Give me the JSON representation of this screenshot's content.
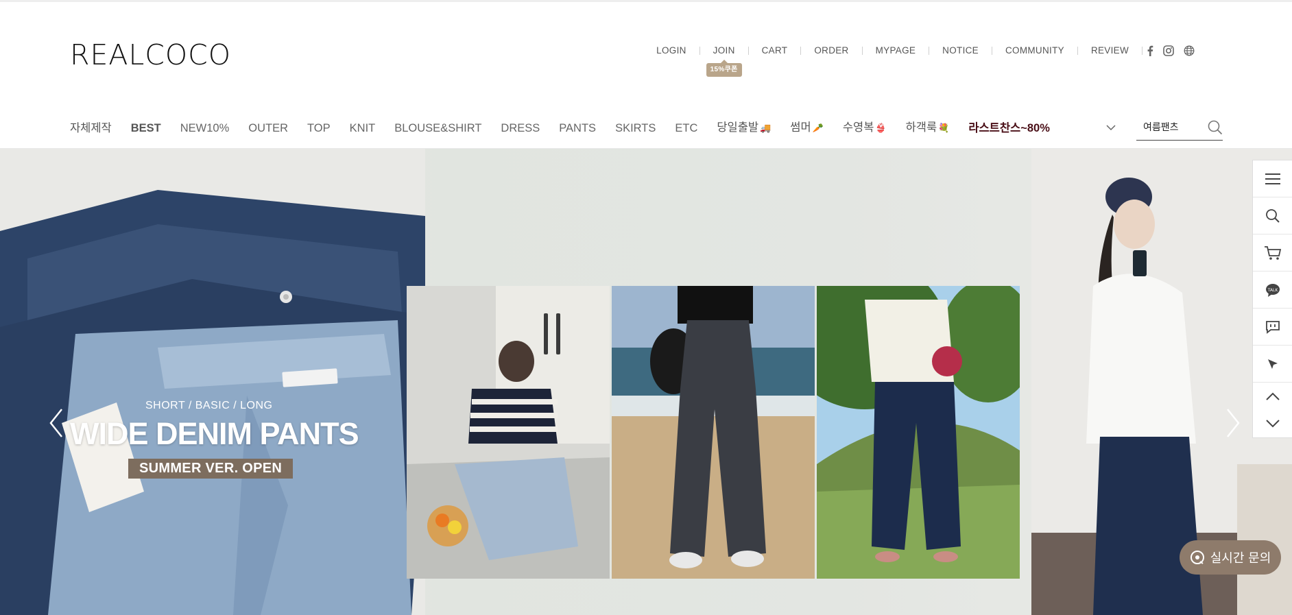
{
  "brand": {
    "logo_text": "REALCOCO"
  },
  "top_nav": {
    "items": [
      "LOGIN",
      "JOIN",
      "CART",
      "ORDER",
      "MYPAGE",
      "NOTICE",
      "COMMUNITY",
      "REVIEW"
    ],
    "join_badge": "15%쿠폰",
    "social_icons": [
      "facebook-icon",
      "instagram-icon",
      "globe-icon"
    ]
  },
  "main_nav": {
    "categories": [
      "자체제작",
      "BEST",
      "NEW10%",
      "OUTER",
      "TOP",
      "KNIT",
      "BLOUSE&SHIRT",
      "DRESS",
      "PANTS",
      "SKIRTS",
      "ETC",
      "당일출발",
      "썸머",
      "수영복",
      "하객룩",
      "라스트찬스~80%"
    ],
    "search_value": "여름팬츠"
  },
  "hero": {
    "subtitle": "SHORT / BASIC / LONG",
    "title": "WIDE DENIM PANTS",
    "tag": "SUMMER VER. OPEN"
  },
  "quick_bar": [
    "menu-icon",
    "search-icon",
    "cart-icon",
    "talk-icon",
    "chat-icon",
    "cursor-icon",
    "scroll-up-icon",
    "scroll-down-icon"
  ],
  "chat_button": {
    "label": "실시간 문의"
  },
  "colors": {
    "coupon_badge": "#b9a58a",
    "sale_text": "#4a0f17",
    "chat_button": "#8e7b6b",
    "tag_bg": "#7d6d5e"
  }
}
